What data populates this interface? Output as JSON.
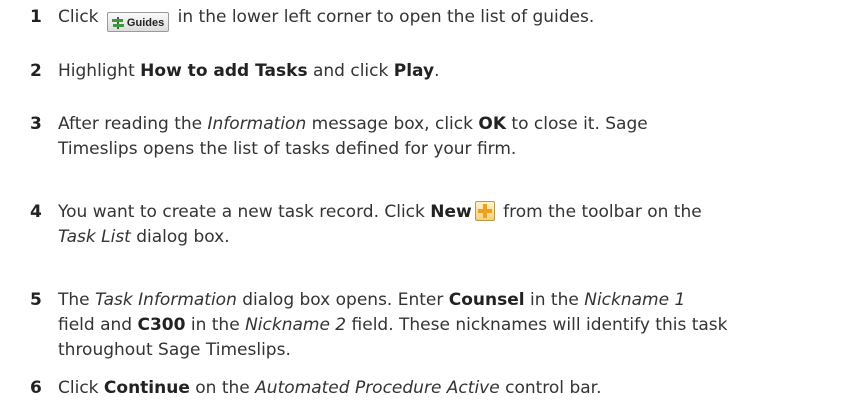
{
  "steps": [
    {
      "num": "1",
      "t1": "Click ",
      "button_label": "Guides",
      "t2": " in the lower left corner to open the list of guides."
    },
    {
      "num": "2",
      "t1": "Highlight ",
      "b1": "How to add Tasks",
      "t2": " and click ",
      "b2": "Play",
      "t3": "."
    },
    {
      "num": "3",
      "t1": "After reading the ",
      "i1": "Information",
      "t2": " message box, click ",
      "b1": "OK",
      "t3": " to close it. Sage",
      "line2": "Timeslips opens the list of tasks defined for your firm."
    },
    {
      "num": "4",
      "t1": "You want to create a new task record. Click ",
      "b1": "New",
      "t2": " from the toolbar on the",
      "i1": "Task List",
      "t3": " dialog box."
    },
    {
      "num": "5",
      "t1": "The ",
      "i1": "Task Information",
      "t2": " dialog box opens. Enter ",
      "b1": "Counsel",
      "t3": " in the ",
      "i2": "Nickname 1",
      "b2": "C300",
      "t4": " field and ",
      "t5": " in the ",
      "i3": "Nickname 2",
      "t6": " field. These nicknames will identify this task",
      "line3": "throughout Sage Timeslips."
    },
    {
      "num": "6",
      "t1": "Click ",
      "b1": "Continue",
      "t2": " on the ",
      "i1": "Automated Procedure Active",
      "t3": " control bar."
    }
  ],
  "icons": {
    "guides": "signpost-icon",
    "new": "plus-icon",
    "accent": "#f0a020"
  }
}
